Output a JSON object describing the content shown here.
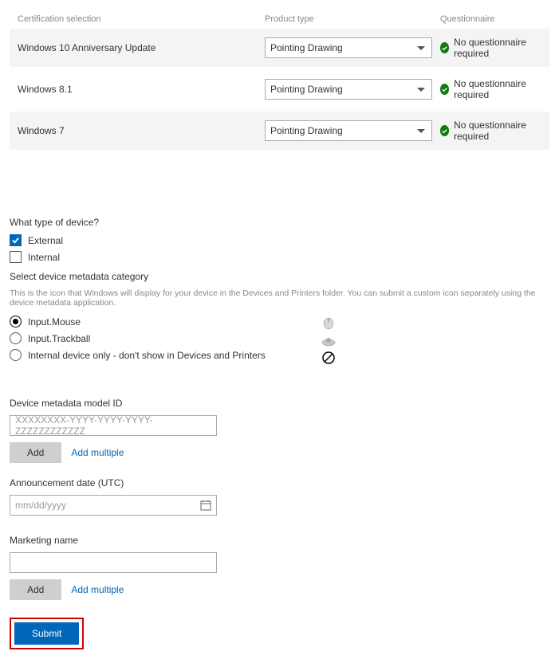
{
  "table": {
    "headers": {
      "certification": "Certification selection",
      "product_type": "Product type",
      "questionnaire": "Questionnaire"
    },
    "rows": [
      {
        "name": "Windows 10 Anniversary Update",
        "product": "Pointing Drawing",
        "quest": "No questionnaire required"
      },
      {
        "name": "Windows 8.1",
        "product": "Pointing Drawing",
        "quest": "No questionnaire required"
      },
      {
        "name": "Windows 7",
        "product": "Pointing Drawing",
        "quest": "No questionnaire required"
      }
    ]
  },
  "device_type": {
    "label": "What type of device?",
    "options": {
      "external": "External",
      "internal": "Internal"
    }
  },
  "metadata": {
    "label": "Select device metadata category",
    "help": "This is the icon that Windows will display for your device in the Devices and Printers folder. You can submit a custom icon separately using the device metadata application.",
    "options": {
      "mouse": "Input.Mouse",
      "trackball": "Input.Trackball",
      "internal_only": "Internal device only - don't show in Devices and Printers"
    }
  },
  "model_id": {
    "label": "Device metadata model ID",
    "placeholder": "XXXXXXXX-YYYY-YYYY-YYYY-ZZZZZZZZZZZZ",
    "add": "Add",
    "add_multiple": "Add multiple"
  },
  "announce": {
    "label": "Announcement date (UTC)",
    "placeholder": "mm/dd/yyyy"
  },
  "marketing": {
    "label": "Marketing name",
    "add": "Add",
    "add_multiple": "Add multiple"
  },
  "submit": "Submit"
}
